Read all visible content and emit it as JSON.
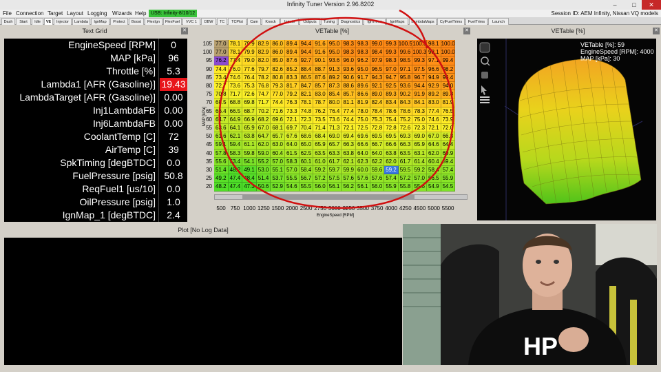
{
  "window": {
    "title": "Infinity Tuner Version 2.96.8202"
  },
  "menu": {
    "items": [
      "File",
      "Connection",
      "Target",
      "Layout",
      "Logging",
      "Wizards",
      "Help"
    ],
    "usb_status": "USB: Infinity-8/10/12",
    "session": "Session ID: AEM Infinity, Nissan VQ models"
  },
  "tabs": [
    "Dash",
    "Start",
    "Idle",
    "VE",
    "Injector",
    "Lambda",
    "IgnMap",
    "Protect",
    "Boost",
    "FlexIgn",
    "FlexFuel",
    "VVC 1",
    "DBW",
    "TC",
    "TCPlot",
    "Cam",
    "Knock",
    "Inputs",
    "Outputs",
    "Tuning",
    "Diagnostics",
    "IgnTrims",
    "IgnMaps",
    "LambdaMaps",
    "CylFuelTrims",
    "FuelTrims",
    "Launch"
  ],
  "active_tab": "VE",
  "text_grid": {
    "title": "Text Grid",
    "rows": [
      {
        "name": "EngineSpeed [RPM]",
        "value": "0"
      },
      {
        "name": "MAP [kPa]",
        "value": "96"
      },
      {
        "name": "Throttle [%]",
        "value": "5.3"
      },
      {
        "name": "Lambda1 [AFR (Gasoline)]",
        "value": "19.43",
        "alarm": true
      },
      {
        "name": "LambdaTarget [AFR (Gasoline)]",
        "value": "0.00"
      },
      {
        "name": "Inj1LambdaFB",
        "value": "0.00"
      },
      {
        "name": "Inj6LambdaFB",
        "value": "0.00"
      },
      {
        "name": "CoolantTemp [C]",
        "value": "72"
      },
      {
        "name": "AirTemp [C]",
        "value": "39"
      },
      {
        "name": "SpkTiming [degBTDC]",
        "value": "0.0"
      },
      {
        "name": "FuelPressure [psig]",
        "value": "50.8"
      },
      {
        "name": "ReqFuel1 [us/10]",
        "value": "0.0"
      },
      {
        "name": "OilPressure [psig]",
        "value": "1.0"
      },
      {
        "name": "IgnMap_1 [degBTDC]",
        "value": "2.4"
      }
    ]
  },
  "ve_table": {
    "title": "VETable [%]",
    "y_axis_label": "MAP [kPa]",
    "x_axis_label": "EngineSpeed [RPM]",
    "map_labels": [
      "105",
      "100",
      "95",
      "90",
      "85",
      "80",
      "75",
      "70",
      "65",
      "60",
      "55",
      "50",
      "45",
      "40",
      "35",
      "30",
      "25",
      "20"
    ],
    "rpm_labels": [
      "500",
      "750",
      "1000",
      "1250",
      "1500",
      "2000",
      "2500",
      "2750",
      "3000",
      "3250",
      "3500",
      "3750",
      "4000",
      "4250",
      "4500",
      "5000",
      "5500"
    ],
    "rows": [
      [
        "77.0",
        "78.1",
        "79.9",
        "82.9",
        "86.0",
        "89.4",
        "94.4",
        "91.6",
        "95.0",
        "98.3",
        "98.3",
        "99.0",
        "99.3",
        "100.5",
        "100.3",
        "98.1",
        "100.0"
      ],
      [
        "77.0",
        "78.1",
        "79.9",
        "82.9",
        "86.0",
        "89.4",
        "94.4",
        "91.6",
        "95.0",
        "98.3",
        "98.3",
        "98.4",
        "99.3",
        "99.6",
        "100.3",
        "98.1",
        "100.0"
      ],
      [
        "76.2",
        "77.4",
        "79.0",
        "82.0",
        "85.0",
        "87.6",
        "92.7",
        "90.1",
        "93.6",
        "96.0",
        "96.2",
        "97.9",
        "98.3",
        "98.5",
        "99.3",
        "97.1",
        "99.4"
      ],
      [
        "74.4",
        "76.0",
        "77.6",
        "79.7",
        "82.6",
        "85.2",
        "88.4",
        "88.7",
        "91.3",
        "93.6",
        "95.0",
        "96.5",
        "97.0",
        "97.1",
        "97.5",
        "96.6",
        "98.2"
      ],
      [
        "73.4",
        "74.6",
        "76.4",
        "78.2",
        "80.8",
        "83.3",
        "86.5",
        "87.6",
        "89.2",
        "90.6",
        "91.7",
        "94.3",
        "94.7",
        "95.8",
        "96.7",
        "94.9",
        "96.4"
      ],
      [
        "72.7",
        "73.6",
        "75.3",
        "76.8",
        "79.3",
        "81.7",
        "84.7",
        "85.7",
        "87.3",
        "88.6",
        "89.6",
        "92.1",
        "92.5",
        "93.6",
        "94.4",
        "92.9",
        "94.0"
      ],
      [
        "70.8",
        "71.7",
        "72.6",
        "74.7",
        "77.0",
        "79.2",
        "82.1",
        "83.0",
        "85.4",
        "85.7",
        "86.6",
        "89.0",
        "89.3",
        "90.2",
        "91.9",
        "89.2",
        "89.8"
      ],
      [
        "68.5",
        "68.8",
        "69.8",
        "71.7",
        "74.4",
        "76.3",
        "78.1",
        "78.7",
        "80.0",
        "81.1",
        "81.9",
        "82.4",
        "83.4",
        "84.3",
        "84.1",
        "83.0",
        "81.9"
      ],
      [
        "66.4",
        "66.5",
        "68.7",
        "70.2",
        "71.6",
        "73.3",
        "74.8",
        "76.2",
        "76.4",
        "77.4",
        "78.0",
        "78.4",
        "78.6",
        "78.6",
        "78.3",
        "77.4",
        "76.5"
      ],
      [
        "64.7",
        "64.9",
        "66.9",
        "68.2",
        "69.6",
        "72.1",
        "72.3",
        "73.5",
        "73.6",
        "74.4",
        "75.0",
        "75.3",
        "75.4",
        "75.2",
        "75.0",
        "74.6",
        "73.9"
      ],
      [
        "63.6",
        "64.1",
        "65.9",
        "67.0",
        "68.1",
        "69.7",
        "70.4",
        "71.4",
        "71.3",
        "72.1",
        "72.5",
        "72.8",
        "72.8",
        "72.6",
        "72.3",
        "72.1",
        "72.0"
      ],
      [
        "61.6",
        "62.1",
        "63.8",
        "64.7",
        "65.7",
        "67.6",
        "68.6",
        "68.4",
        "69.0",
        "69.4",
        "69.6",
        "69.5",
        "69.5",
        "69.3",
        "69.0",
        "67.0",
        "66.8"
      ],
      [
        "59.1",
        "59.4",
        "61.1",
        "62.0",
        "63.0",
        "64.0",
        "65.0",
        "65.9",
        "65.7",
        "66.3",
        "66.6",
        "66.7",
        "66.6",
        "66.3",
        "65.9",
        "64.6",
        "64.4"
      ],
      [
        "57.8",
        "58.3",
        "59.8",
        "59.0",
        "60.4",
        "61.5",
        "62.5",
        "63.5",
        "63.3",
        "63.8",
        "64.0",
        "64.0",
        "63.8",
        "63.5",
        "63.1",
        "62.0",
        "60.9"
      ],
      [
        "55.6",
        "53.4",
        "54.1",
        "55.2",
        "57.0",
        "58.3",
        "60.1",
        "61.0",
        "61.7",
        "62.1",
        "62.3",
        "62.2",
        "62.0",
        "61.7",
        "61.4",
        "60.4",
        "59.4"
      ],
      [
        "51.4",
        "48.2",
        "49.1",
        "53.0",
        "55.1",
        "57.0",
        "58.4",
        "59.2",
        "59.7",
        "59.9",
        "60.0",
        "59.6",
        "59.2",
        "59.5",
        "59.2",
        "58.4",
        "57.4"
      ],
      [
        "49.2",
        "47.4",
        "48.4",
        "51.4",
        "53.7",
        "55.5",
        "56.7",
        "57.2",
        "57.5",
        "57.6",
        "57.6",
        "57.6",
        "57.4",
        "57.2",
        "57.0",
        "56.5",
        "55.9"
      ],
      [
        "48.2",
        "47.4",
        "47.3",
        "50.6",
        "52.9",
        "54.6",
        "55.5",
        "56.0",
        "56.1",
        "56.2",
        "56.1",
        "56.0",
        "55.9",
        "55.8",
        "55.6",
        "54.9",
        "54.5"
      ]
    ],
    "highlight": {
      "row": 15,
      "col": 12,
      "value": "59.2"
    }
  },
  "ve_3d": {
    "title": "VETable [%]",
    "readout_line1": "VETable [%]: 59",
    "readout_line2": "EngineSpeed [RPM]: 4000",
    "readout_line3": "MAP [kPa]: 30"
  },
  "plot": {
    "title": "Plot [No Log Data]"
  },
  "webcam": {
    "shirt_text": "HP"
  },
  "colors": {
    "alarm": "#e8161a",
    "usb": "#39c23a",
    "annotation": "#d01010"
  }
}
